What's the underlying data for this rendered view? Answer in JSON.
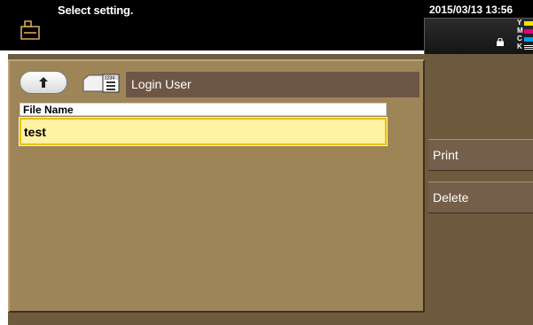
{
  "header": {
    "message": "Select setting.",
    "datetime": "2015/03/13 13:56",
    "toner": [
      {
        "label": "Y",
        "color": "#f5e400"
      },
      {
        "label": "M",
        "color": "#e4007f"
      },
      {
        "label": "C",
        "color": "#00a0e9"
      },
      {
        "label": "K",
        "color": "#ffffff"
      }
    ]
  },
  "path": {
    "label": "Login User",
    "box_number": "1234"
  },
  "file": {
    "header": "File Name",
    "value": "test"
  },
  "actions": {
    "print_label": "Print",
    "delete_label": "Delete"
  },
  "colors": {
    "panel": "#9e8558",
    "background": "#6e5a3d",
    "selected_field": "#fff2a3",
    "selected_border": "#e8c000"
  }
}
